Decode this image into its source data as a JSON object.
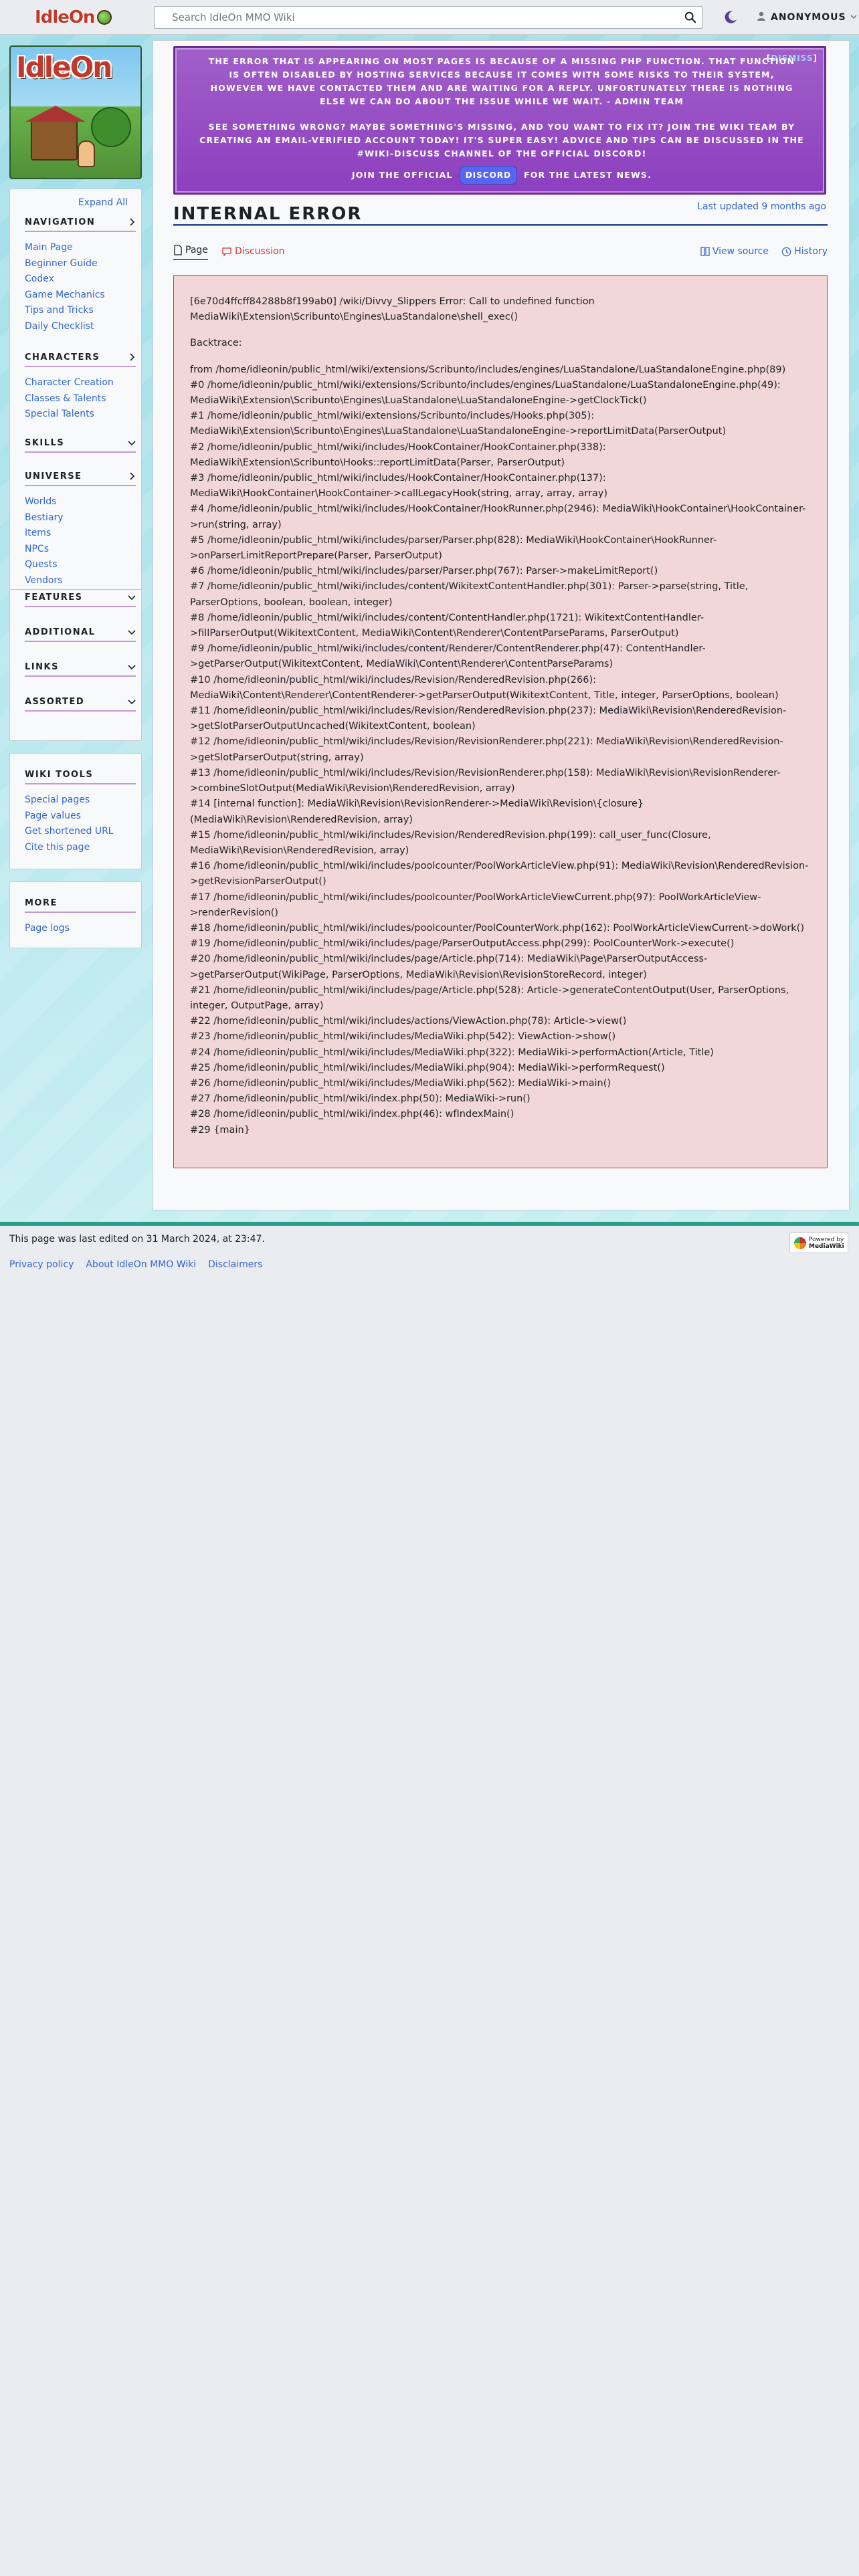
{
  "header": {
    "logo_text": "IdleOn",
    "search_placeholder": "Search IdleOn MMO Wiki",
    "user_label": "ANONYMOUS"
  },
  "sidebar": {
    "logo_text": "IdleOn",
    "expand_all": "Expand All",
    "sections": [
      {
        "title": "NAVIGATION",
        "items": [
          "Main Page",
          "Beginner Guide",
          "Codex",
          "Game Mechanics",
          "Tips and Tricks",
          "Daily Checklist"
        ]
      },
      {
        "title": "CHARACTERS",
        "items": [
          "Character Creation",
          "Classes & Talents",
          "Special Talents"
        ]
      },
      {
        "title": "SKILLS",
        "items": []
      },
      {
        "title": "UNIVERSE",
        "items": [
          "Worlds",
          "Bestiary",
          "Items",
          "NPCs",
          "Quests",
          "Vendors"
        ]
      },
      {
        "title": "FEATURES",
        "items": []
      },
      {
        "title": "ADDITIONAL",
        "items": []
      },
      {
        "title": "LINKS",
        "items": []
      },
      {
        "title": "ASSORTED",
        "items": []
      }
    ],
    "tools": {
      "title": "WIKI TOOLS",
      "items": [
        "Special pages",
        "Page values",
        "Get shortened URL",
        "Cite this page"
      ]
    },
    "more": {
      "title": "MORE",
      "items": [
        "Page logs"
      ]
    }
  },
  "sitenotice": {
    "dismiss_prefix": "[",
    "dismiss_link": "DISMISS",
    "dismiss_suffix": "]",
    "p1": "The error that is appearing on most pages is because of a missing PHP function. That function is often disabled by hosting services because it comes with some risks to their system, however we have contacted them and are waiting for a reply. Unfortunately there is nothing else we can do about the issue while we wait. - Admin Team",
    "p2": "See something wrong? Maybe something's missing, and you want to fix it? Join the Wiki Team by creating an email-verified account today! It's super easy! Advice and tips can be discussed in the #wiki-discuss channel of the official Discord!",
    "p3_before": "Join the official",
    "p3_badge": "DISCORD",
    "p3_after": "for the latest news."
  },
  "page": {
    "title": "INTERNAL ERROR",
    "last_updated": "Last updated 9 months ago",
    "tabs": {
      "page": "Page",
      "discussion": "Discussion",
      "view_source": "View source",
      "history": "History"
    }
  },
  "error": {
    "summary": "[6e70d4ffcff84288b8f199ab0] /wiki/Divvy_Slippers Error: Call to undefined function MediaWiki\\Extension\\Scribunto\\Engines\\LuaStandalone\\shell_exec()",
    "backtrace_label": "Backtrace:",
    "trace": [
      "from /home/idleonin/public_html/wiki/extensions/Scribunto/includes/engines/LuaStandalone/LuaStandaloneEngine.php(89)",
      "#0 /home/idleonin/public_html/wiki/extensions/Scribunto/includes/engines/LuaStandalone/LuaStandaloneEngine.php(49): MediaWiki\\Extension\\Scribunto\\Engines\\LuaStandalone\\LuaStandaloneEngine->getClockTick()",
      "#1 /home/idleonin/public_html/wiki/extensions/Scribunto/includes/Hooks.php(305): MediaWiki\\Extension\\Scribunto\\Engines\\LuaStandalone\\LuaStandaloneEngine->reportLimitData(ParserOutput)",
      "#2 /home/idleonin/public_html/wiki/includes/HookContainer/HookContainer.php(338): MediaWiki\\Extension\\Scribunto\\Hooks::reportLimitData(Parser, ParserOutput)",
      "#3 /home/idleonin/public_html/wiki/includes/HookContainer/HookContainer.php(137): MediaWiki\\HookContainer\\HookContainer->callLegacyHook(string, array, array, array)",
      "#4 /home/idleonin/public_html/wiki/includes/HookContainer/HookRunner.php(2946): MediaWiki\\HookContainer\\HookContainer->run(string, array)",
      "#5 /home/idleonin/public_html/wiki/includes/parser/Parser.php(828): MediaWiki\\HookContainer\\HookRunner->onParserLimitReportPrepare(Parser, ParserOutput)",
      "#6 /home/idleonin/public_html/wiki/includes/parser/Parser.php(767): Parser->makeLimitReport()",
      "#7 /home/idleonin/public_html/wiki/includes/content/WikitextContentHandler.php(301): Parser->parse(string, Title, ParserOptions, boolean, boolean, integer)",
      "#8 /home/idleonin/public_html/wiki/includes/content/ContentHandler.php(1721): WikitextContentHandler->fillParserOutput(WikitextContent, MediaWiki\\Content\\Renderer\\ContentParseParams, ParserOutput)",
      "#9 /home/idleonin/public_html/wiki/includes/content/Renderer/ContentRenderer.php(47): ContentHandler->getParserOutput(WikitextContent, MediaWiki\\Content\\Renderer\\ContentParseParams)",
      "#10 /home/idleonin/public_html/wiki/includes/Revision/RenderedRevision.php(266): MediaWiki\\Content\\Renderer\\ContentRenderer->getParserOutput(WikitextContent, Title, integer, ParserOptions, boolean)",
      "#11 /home/idleonin/public_html/wiki/includes/Revision/RenderedRevision.php(237): MediaWiki\\Revision\\RenderedRevision->getSlotParserOutputUncached(WikitextContent, boolean)",
      "#12 /home/idleonin/public_html/wiki/includes/Revision/RevisionRenderer.php(221): MediaWiki\\Revision\\RenderedRevision->getSlotParserOutput(string, array)",
      "#13 /home/idleonin/public_html/wiki/includes/Revision/RevisionRenderer.php(158): MediaWiki\\Revision\\RevisionRenderer->combineSlotOutput(MediaWiki\\Revision\\RenderedRevision, array)",
      "#14 [internal function]: MediaWiki\\Revision\\RevisionRenderer->MediaWiki\\Revision\\{closure}(MediaWiki\\Revision\\RenderedRevision, array)",
      "#15 /home/idleonin/public_html/wiki/includes/Revision/RenderedRevision.php(199): call_user_func(Closure, MediaWiki\\Revision\\RenderedRevision, array)",
      "#16 /home/idleonin/public_html/wiki/includes/poolcounter/PoolWorkArticleView.php(91): MediaWiki\\Revision\\RenderedRevision->getRevisionParserOutput()",
      "#17 /home/idleonin/public_html/wiki/includes/poolcounter/PoolWorkArticleViewCurrent.php(97): PoolWorkArticleView->renderRevision()",
      "#18 /home/idleonin/public_html/wiki/includes/poolcounter/PoolCounterWork.php(162): PoolWorkArticleViewCurrent->doWork()",
      "#19 /home/idleonin/public_html/wiki/includes/page/ParserOutputAccess.php(299): PoolCounterWork->execute()",
      "#20 /home/idleonin/public_html/wiki/includes/page/Article.php(714): MediaWiki\\Page\\ParserOutputAccess->getParserOutput(WikiPage, ParserOptions, MediaWiki\\Revision\\RevisionStoreRecord, integer)",
      "#21 /home/idleonin/public_html/wiki/includes/page/Article.php(528): Article->generateContentOutput(User, ParserOptions, integer, OutputPage, array)",
      "#22 /home/idleonin/public_html/wiki/includes/actions/ViewAction.php(78): Article->view()",
      "#23 /home/idleonin/public_html/wiki/includes/MediaWiki.php(542): ViewAction->show()",
      "#24 /home/idleonin/public_html/wiki/includes/MediaWiki.php(322): MediaWiki->performAction(Article, Title)",
      "#25 /home/idleonin/public_html/wiki/includes/MediaWiki.php(904): MediaWiki->performRequest()",
      "#26 /home/idleonin/public_html/wiki/includes/MediaWiki.php(562): MediaWiki->main()",
      "#27 /home/idleonin/public_html/wiki/index.php(50): MediaWiki->run()",
      "#28 /home/idleonin/public_html/wiki/index.php(46): wfIndexMain()",
      "#29 {main}"
    ]
  },
  "footer": {
    "last_modified": "This page was last edited on 31 March 2024, at 23:47.",
    "links": [
      "Privacy policy",
      "About IdleOn MMO Wiki",
      "Disclaimers"
    ],
    "powered_line1": "Powered by",
    "powered_line2": "MediaWiki"
  }
}
